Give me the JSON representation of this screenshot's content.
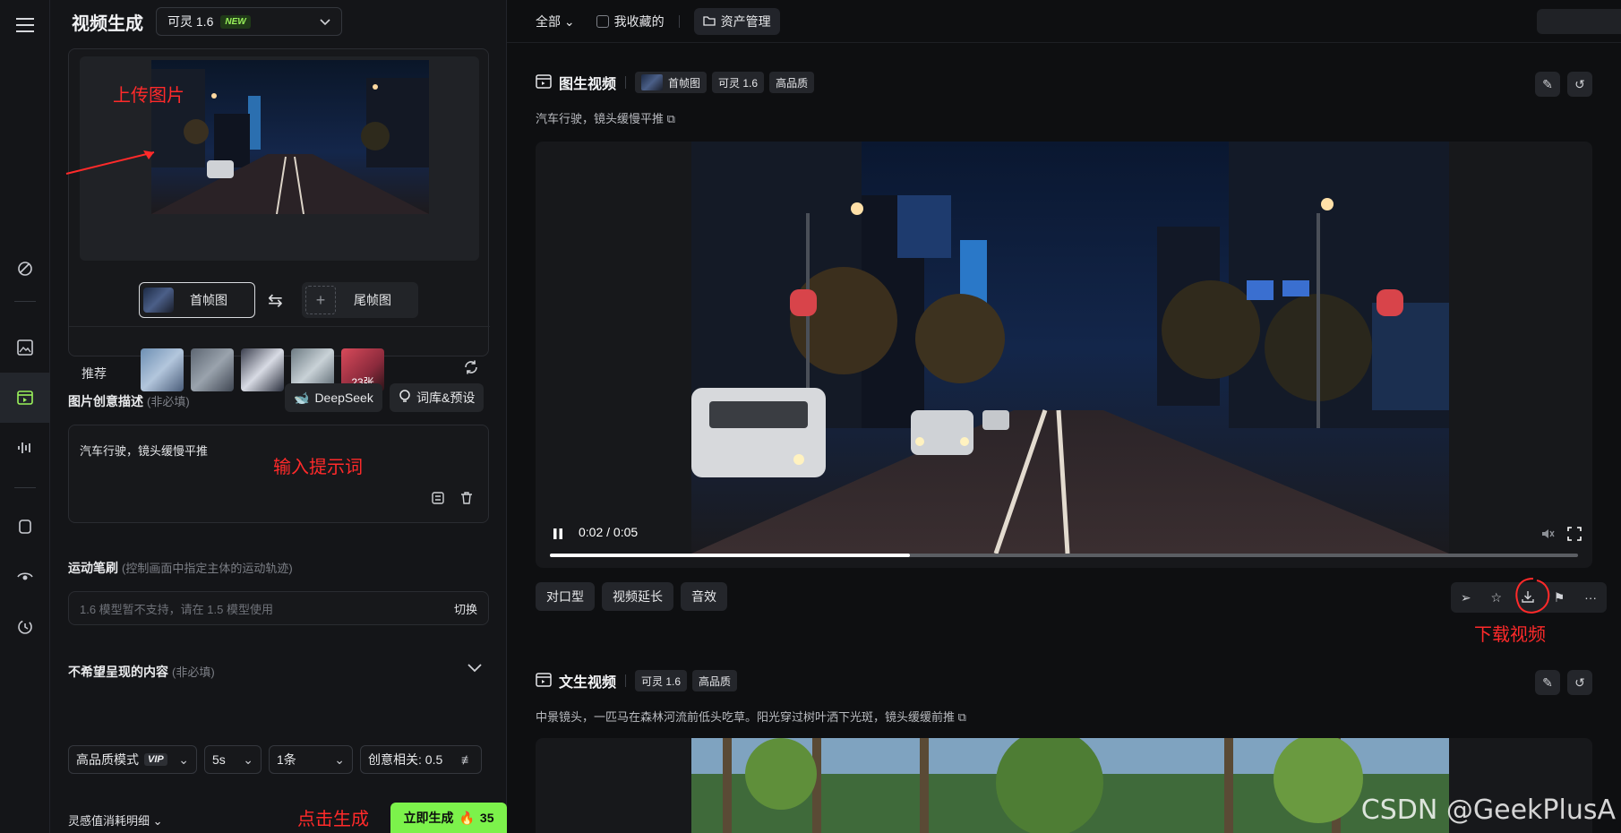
{
  "left_panel": {
    "title": "视频生成",
    "model_name": "可灵 1.6",
    "model_badge": "NEW",
    "upload_annotation": "上传图片",
    "first_frame_label": "首帧图",
    "last_frame_label": "尾帧图",
    "recommend_label": "推荐",
    "more_count": "23张",
    "prompt_section_label": "图片创意描述",
    "prompt_optional": "(非必填)",
    "deepseek_label": "DeepSeek",
    "library_label": "词库&预设",
    "prompt_text": "汽车行驶，镜头缓慢平推",
    "prompt_annotation": "输入提示词",
    "motion_label": "运动笔刷",
    "motion_hint": "(控制画面中指定主体的运动轨迹)",
    "motion_placeholder": "1.6 模型暂不支持，请在 1.5 模型使用",
    "motion_switch": "切换",
    "negative_label": "不希望呈现的内容",
    "negative_optional": "(非必填)",
    "mode_label": "高品质模式",
    "vip_badge": "VIP",
    "duration": "5s",
    "count": "1条",
    "creativity": "创意相关: 0.5",
    "cost_label": "灵感值消耗明细",
    "generate_annotation": "点击生成",
    "generate_label": "立即生成",
    "generate_cost": "35"
  },
  "main": {
    "filter_all": "全部",
    "favorites_label": "我收藏的",
    "assets_label": "资产管理",
    "card1": {
      "title": "图生视频",
      "tags": [
        "首帧图",
        "可灵 1.6",
        "高品质"
      ],
      "description": "汽车行驶，镜头缓慢平推",
      "time": "0:02 / 0:05",
      "progress": 0.35,
      "actions": [
        "对口型",
        "视频延长",
        "音效"
      ],
      "download_annotation": "下载视频"
    },
    "card2": {
      "title": "文生视频",
      "tags": [
        "可灵 1.6",
        "高品质"
      ],
      "description": "中景镜头，一匹马在森林河流前低头吃草。阳光穿过树叶洒下光斑，镜头缓缓前推"
    },
    "watermark": "CSDN @GeekPlusA"
  },
  "colors": {
    "accent_green": "#7cf24b",
    "annotation_red": "#ff2a2a"
  }
}
